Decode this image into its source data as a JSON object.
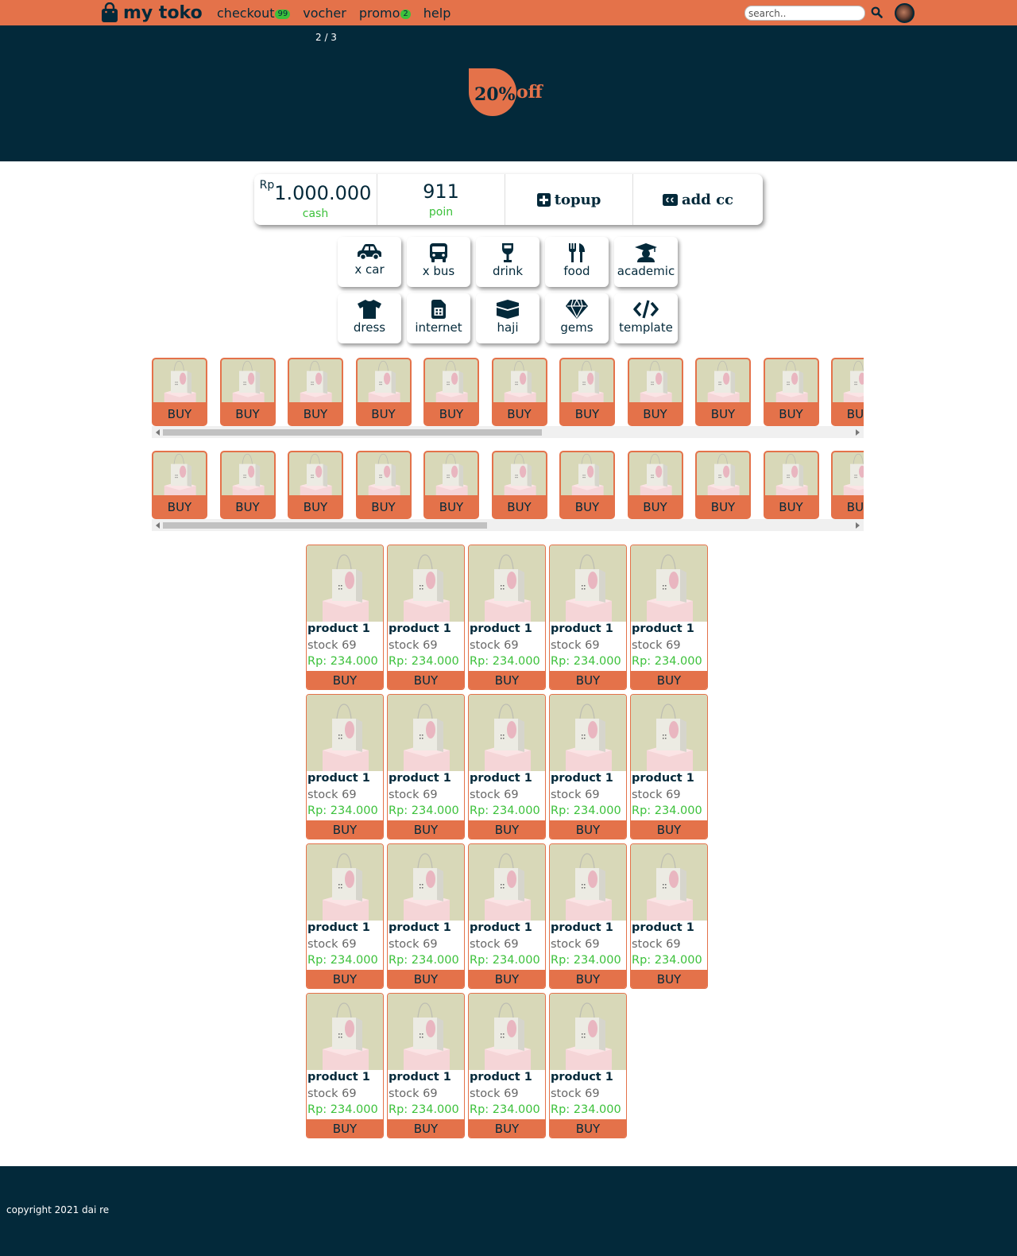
{
  "navbar": {
    "brand": "my toko",
    "links": [
      {
        "label": "checkout",
        "badge": "99"
      },
      {
        "label": "vocher",
        "badge": ""
      },
      {
        "label": "promo",
        "badge": "2"
      },
      {
        "label": "help",
        "badge": ""
      }
    ],
    "search_placeholder": "search.."
  },
  "banner": {
    "slide_counter": "2 / 3",
    "promo_percent": "20%",
    "promo_word": "off"
  },
  "wallet": {
    "currency": "Rp",
    "cash_value": "1.000.000",
    "cash_label": "cash",
    "poin_value": "911",
    "poin_label": "poin",
    "topup_label": "topup",
    "addcc_label": "add cc"
  },
  "categories": [
    {
      "label": "x car",
      "icon": "car-icon"
    },
    {
      "label": "x bus",
      "icon": "bus-icon"
    },
    {
      "label": "drink",
      "icon": "wine-glass-icon"
    },
    {
      "label": "food",
      "icon": "utensils-icon"
    },
    {
      "label": "academic",
      "icon": "graduation-cap-icon"
    },
    {
      "label": "dress",
      "icon": "tshirt-icon"
    },
    {
      "label": "internet",
      "icon": "sim-card-icon"
    },
    {
      "label": "haji",
      "icon": "kaaba-icon"
    },
    {
      "label": "gems",
      "icon": "gem-icon"
    },
    {
      "label": "template",
      "icon": "code-icon"
    }
  ],
  "strips": [
    {
      "buy_label": "BUY",
      "items": 11,
      "scroll_fraction": 0.55
    },
    {
      "buy_label": "BUY",
      "items": 11,
      "scroll_fraction": 0.47
    }
  ],
  "products": {
    "buy_label": "BUY",
    "items": [
      {
        "name": "product 1",
        "stock": "stock 69",
        "price": "Rp: 234.000"
      },
      {
        "name": "product 1",
        "stock": "stock 69",
        "price": "Rp: 234.000"
      },
      {
        "name": "product 1",
        "stock": "stock 69",
        "price": "Rp: 234.000"
      },
      {
        "name": "product 1",
        "stock": "stock 69",
        "price": "Rp: 234.000"
      },
      {
        "name": "product 1",
        "stock": "stock 69",
        "price": "Rp: 234.000"
      },
      {
        "name": "product 1",
        "stock": "stock 69",
        "price": "Rp: 234.000"
      },
      {
        "name": "product 1",
        "stock": "stock 69",
        "price": "Rp: 234.000"
      },
      {
        "name": "product 1",
        "stock": "stock 69",
        "price": "Rp: 234.000"
      },
      {
        "name": "product 1",
        "stock": "stock 69",
        "price": "Rp: 234.000"
      },
      {
        "name": "product 1",
        "stock": "stock 69",
        "price": "Rp: 234.000"
      },
      {
        "name": "product 1",
        "stock": "stock 69",
        "price": "Rp: 234.000"
      },
      {
        "name": "product 1",
        "stock": "stock 69",
        "price": "Rp: 234.000"
      },
      {
        "name": "product 1",
        "stock": "stock 69",
        "price": "Rp: 234.000"
      },
      {
        "name": "product 1",
        "stock": "stock 69",
        "price": "Rp: 234.000"
      },
      {
        "name": "product 1",
        "stock": "stock 69",
        "price": "Rp: 234.000"
      },
      {
        "name": "product 1",
        "stock": "stock 69",
        "price": "Rp: 234.000"
      },
      {
        "name": "product 1",
        "stock": "stock 69",
        "price": "Rp: 234.000"
      },
      {
        "name": "product 1",
        "stock": "stock 69",
        "price": "Rp: 234.000"
      },
      {
        "name": "product 1",
        "stock": "stock 69",
        "price": "Rp: 234.000"
      }
    ]
  },
  "footer": {
    "copyright": "copyright 2021 dai re"
  },
  "colors": {
    "accent": "#e4724a",
    "dark": "#03293a",
    "green": "#3cc13b"
  }
}
